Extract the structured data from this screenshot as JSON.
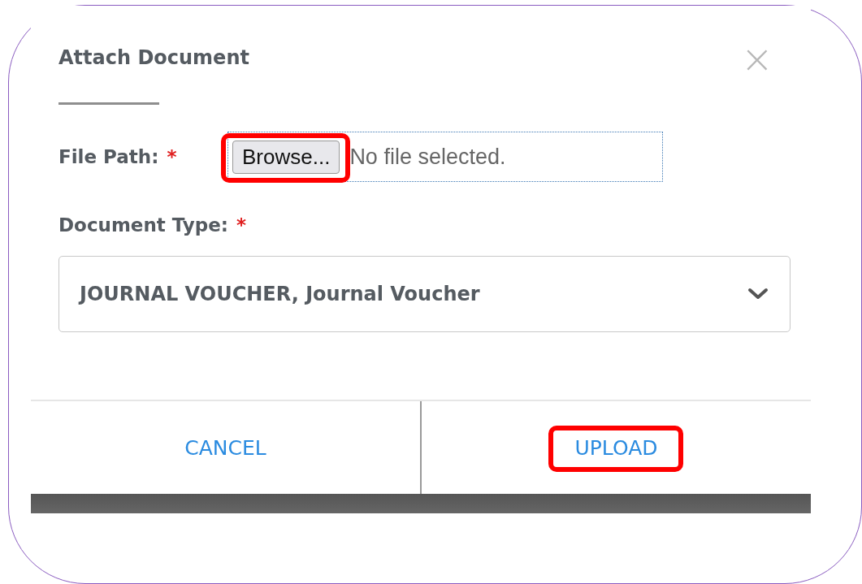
{
  "dialog": {
    "title": "Attach Document",
    "close": "×"
  },
  "file_path": {
    "label": "File Path:",
    "required_mark": "*",
    "button": "Browse...",
    "button_highlighted": true,
    "status": "No file selected."
  },
  "document_type": {
    "label": "Document Type:",
    "required_mark": "*",
    "value": "JOURNAL VOUCHER, Journal Voucher"
  },
  "buttons": [
    {
      "label": "CANCEL",
      "highlighted": false
    },
    {
      "label": "UPLOAD",
      "highlighted": true
    }
  ]
}
